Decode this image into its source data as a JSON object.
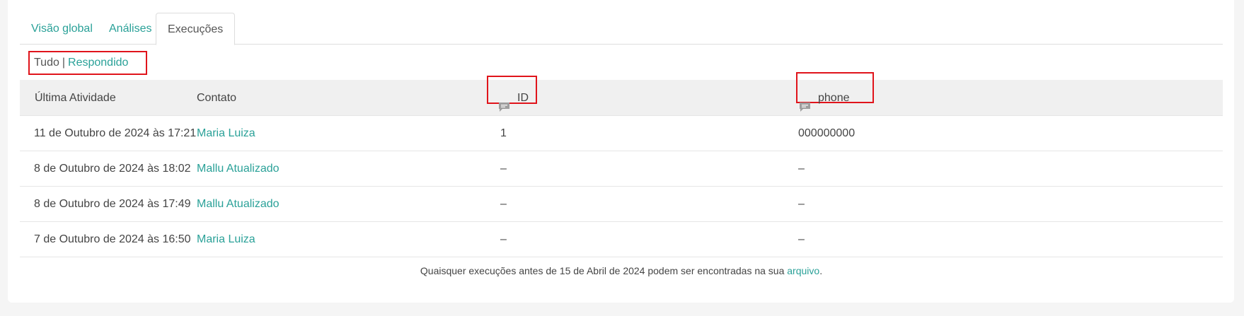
{
  "tabs": [
    {
      "label": "Visão global",
      "active": false
    },
    {
      "label": "Análises",
      "active": false
    },
    {
      "label": "Execuções",
      "active": true
    }
  ],
  "filters": {
    "all_label": "Tudo",
    "separator": "|",
    "responded_label": "Respondido"
  },
  "table": {
    "headers": {
      "last_activity": "Última Atividade",
      "contact": "Contato",
      "id": "ID",
      "phone": "phone"
    },
    "header_icon": "chat-bubble-icon",
    "rows": [
      {
        "last_activity": "11 de Outubro de 2024 às 17:21",
        "contact": "Maria Luiza",
        "id": "1",
        "phone": "000000000"
      },
      {
        "last_activity": "8 de Outubro de 2024 às 18:02",
        "contact": "Mallu Atualizado",
        "id": "–",
        "phone": "–"
      },
      {
        "last_activity": "8 de Outubro de 2024 às 17:49",
        "contact": "Mallu Atualizado",
        "id": "–",
        "phone": "–"
      },
      {
        "last_activity": "7 de Outubro de 2024 às 16:50",
        "contact": "Maria Luiza",
        "id": "–",
        "phone": "–"
      }
    ]
  },
  "footer": {
    "text": "Quaisquer execuções antes de 15 de Abril de 2024 podem ser encontradas na sua",
    "link": "arquivo",
    "period": "."
  },
  "colors": {
    "accent": "#2aa198",
    "highlight": "#e0141b",
    "header_bg": "#f0f0f0"
  }
}
